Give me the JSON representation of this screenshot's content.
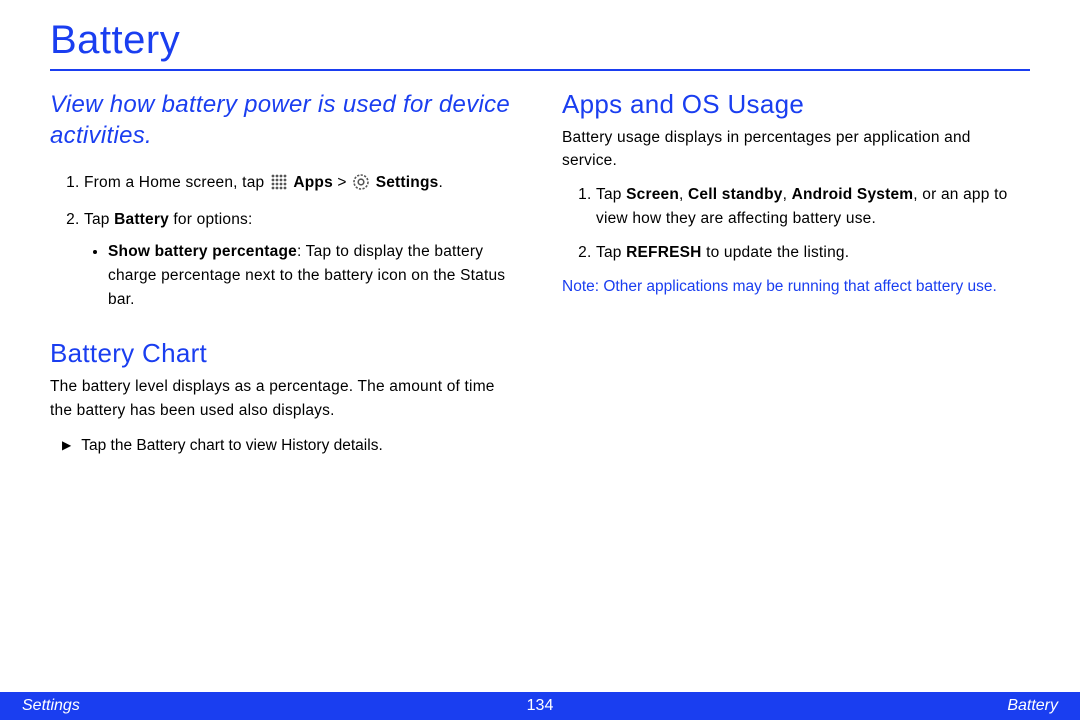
{
  "title": "Battery",
  "left": {
    "intro": "View how battery power is used for device activities.",
    "steps": {
      "s1_a": "From a Home screen, tap ",
      "s1_apps": "Apps",
      "s1_gt": " > ",
      "s1_settings": "Settings",
      "s1_end": ".",
      "s2_a": "Tap ",
      "s2_bold": "Battery",
      "s2_b": " for options:",
      "bullet_bold": "Show battery percentage",
      "bullet_rest": ": Tap to display the battery charge percentage next to the battery icon on the Status bar."
    },
    "chart": {
      "heading": "Battery Chart",
      "body": "The battery level displays as a percentage. The amount of time the battery has been used also displays.",
      "arrow": "Tap the Battery chart to view History details."
    }
  },
  "right": {
    "heading": "Apps and OS Usage",
    "body": "Battery usage displays in percentages per application and service.",
    "steps": {
      "s1_a": "Tap ",
      "s1_b1": "Screen",
      "s1_c1": ", ",
      "s1_b2": "Cell standby",
      "s1_c2": ", ",
      "s1_b3": "Android System",
      "s1_rest": ", or an app to view how they are affecting battery use.",
      "s2_a": "Tap ",
      "s2_bold": "REFRESH",
      "s2_b": " to update the listing."
    },
    "note_label": "Note",
    "note_rest": ": Other applications may be running that affect battery use."
  },
  "footer": {
    "left": "Settings",
    "center": "134",
    "right": "Battery"
  }
}
